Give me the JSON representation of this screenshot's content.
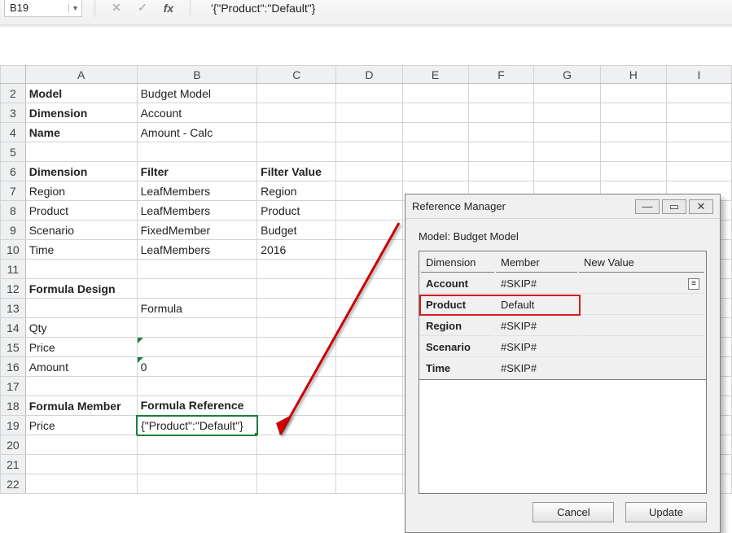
{
  "name_box": "B19",
  "formula": "'{\"Product\":\"Default\"}",
  "columns": [
    "",
    "A",
    "B",
    "C",
    "D",
    "E",
    "F",
    "G",
    "H",
    "I"
  ],
  "rows": [
    {
      "n": "2",
      "a": "Model",
      "a_bold": true,
      "b": "Budget Model",
      "c": ""
    },
    {
      "n": "3",
      "a": "Dimension",
      "a_bold": true,
      "b": "Account",
      "c": ""
    },
    {
      "n": "4",
      "a": "Name",
      "a_bold": true,
      "b": "Amount - Calc",
      "c": ""
    },
    {
      "n": "5",
      "a": "",
      "b": "",
      "c": ""
    },
    {
      "n": "6",
      "shade": true,
      "a": "Dimension",
      "a_bold": true,
      "b": "Filter",
      "b_bold": true,
      "c": "Filter Value",
      "c_bold": true
    },
    {
      "n": "7",
      "a": "Region",
      "b": "LeafMembers",
      "c": "Region"
    },
    {
      "n": "8",
      "a": "Product",
      "b": "LeafMembers",
      "c": "Product"
    },
    {
      "n": "9",
      "a": "Scenario",
      "b": "FixedMember",
      "c": "Budget"
    },
    {
      "n": "10",
      "a": "Time",
      "b": "LeafMembers",
      "c": "2016"
    },
    {
      "n": "11",
      "a": "",
      "b": "",
      "c": ""
    },
    {
      "n": "12",
      "shade_a": true,
      "a": "Formula Design",
      "a_bold": true,
      "b": "",
      "c": ""
    },
    {
      "n": "13",
      "a": "",
      "shade_b": true,
      "b": "Formula",
      "c": ""
    },
    {
      "n": "14",
      "a": "Qty",
      "b": "",
      "c": ""
    },
    {
      "n": "15",
      "a": "Price",
      "b": "",
      "b_tri": true,
      "c": ""
    },
    {
      "n": "16",
      "a": "Amount",
      "b": "0",
      "b_tri": true,
      "b_right": true,
      "c": ""
    },
    {
      "n": "17",
      "a": "",
      "b": "",
      "c": ""
    },
    {
      "n": "18",
      "shade": true,
      "a": "Formula Member",
      "a_bold": true,
      "b": "Formula Reference",
      "b_bold": true,
      "c": ""
    },
    {
      "n": "19",
      "sel": true,
      "a": "Price",
      "b": "{\"Product\":\"Default\"}",
      "b_sel": true,
      "c": ""
    },
    {
      "n": "20",
      "a": "",
      "b": "",
      "c": ""
    },
    {
      "n": "21",
      "a": "",
      "b": "",
      "c": ""
    },
    {
      "n": "22",
      "a": "",
      "b": "",
      "c": ""
    }
  ],
  "dialog": {
    "title": "Reference Manager",
    "model_label": "Model:",
    "model_value": "Budget Model",
    "headers": {
      "dim": "Dimension",
      "mem": "Member",
      "nv": "New Value"
    },
    "rows": [
      {
        "dim": "Account",
        "mem": "#SKIP#",
        "hamburger": true
      },
      {
        "dim": "Product",
        "mem": "Default",
        "highlight": true
      },
      {
        "dim": "Region",
        "mem": "#SKIP#"
      },
      {
        "dim": "Scenario",
        "mem": "#SKIP#"
      },
      {
        "dim": "Time",
        "mem": "#SKIP#"
      }
    ],
    "cancel": "Cancel",
    "update": "Update"
  }
}
